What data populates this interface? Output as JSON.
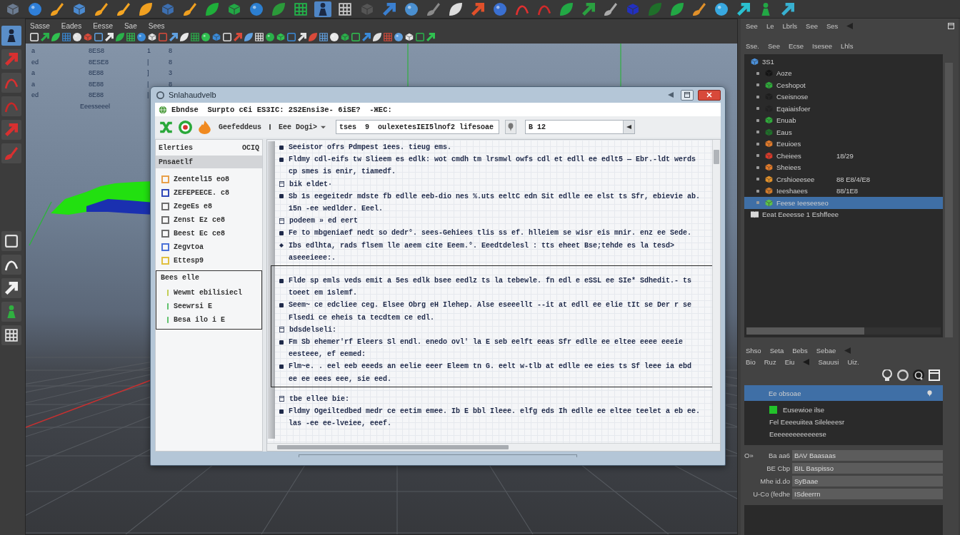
{
  "shelf": [
    {
      "selected": false
    },
    {
      "selected": false
    },
    {
      "selected": false
    },
    {
      "selected": false
    },
    {
      "selected": false
    },
    {
      "selected": false
    },
    {
      "selected": false
    },
    {
      "selected": false
    },
    {
      "selected": false
    },
    {
      "selected": false
    },
    {
      "selected": false
    },
    {
      "selected": false
    },
    {
      "selected": false
    },
    {
      "selected": false
    },
    {
      "selected": true
    },
    {
      "selected": false
    },
    {
      "selected": false
    },
    {
      "selected": false
    },
    {
      "selected": false
    },
    {
      "selected": false
    },
    {
      "selected": false
    },
    {
      "selected": false
    },
    {
      "selected": false
    },
    {
      "selected": false
    },
    {
      "selected": false
    },
    {
      "selected": false
    },
    {
      "selected": false
    },
    {
      "selected": false
    },
    {
      "selected": false
    },
    {
      "selected": false
    },
    {
      "selected": false
    },
    {
      "selected": false
    },
    {
      "selected": false
    },
    {
      "selected": false
    },
    {
      "selected": false
    },
    {
      "selected": false
    }
  ],
  "tools": [
    {
      "selected": true
    },
    {
      "selected": false
    },
    {
      "selected": false
    },
    {
      "selected": false
    },
    {
      "selected": false
    },
    {
      "selected": false
    },
    {
      "selected": false
    },
    {
      "selected": false
    },
    {
      "selected": false
    },
    {
      "selected": false
    },
    {
      "selected": false
    }
  ],
  "viewport": {
    "menu": [
      "Sasse",
      "Eades",
      "Eesse",
      "Sae",
      "Sees"
    ],
    "hud": {
      "rows": [
        {
          "label": "a",
          "value": "8ES8",
          "column_3": "1",
          "column_4": "8"
        },
        {
          "label": "ed",
          "value": "8ESE8",
          "column_3": "|",
          "column_4": "8"
        },
        {
          "label": "a",
          "value": "8E88",
          "column_3": "]",
          "column_4": "3"
        },
        {
          "label": "a",
          "value": "8E88",
          "column_3": "|",
          "column_4": "8"
        },
        {
          "label": "ed",
          "value": "8E88",
          "column_3": "|"
        }
      ],
      "footer": "Eeesseeel"
    }
  },
  "dialog": {
    "title": "Snlahaudvelb",
    "address": "Ebndse  Surpto cЄi ES3IC: 2S2Ensi3e- 6iSE?  -ЖEC:",
    "toolbar": {
      "menu_1": "Geefeddeus",
      "menu_2": "Eee Dogi>",
      "dropdown": "tses  9  oulexetesIEI5lnof2 lifesoae",
      "search": "B 12"
    },
    "sidebar": {
      "header": "Elerties",
      "header_tools": "OCIQ",
      "items": [
        {
          "label": "Pnsaetlf",
          "selected": true
        },
        {
          "label": "Zeentel15 eo8",
          "selected": false,
          "color": "#e8a04a"
        },
        {
          "label": "ZEFEPEECE. c8",
          "selected": false,
          "color": "#3048b8"
        },
        {
          "label": "ZegeEs e8",
          "selected": false,
          "color": "#6e6e6e"
        },
        {
          "label": "Zenst Ez ce8",
          "selected": false,
          "color": "#6e6e6e"
        },
        {
          "label": "Beest Ec ce8",
          "selected": false,
          "color": "#6e6e6e"
        },
        {
          "label": "Zegvtoa",
          "selected": false,
          "color": "#4c72d8"
        },
        {
          "label": "Ettesp9",
          "selected": false,
          "color": "#e0c040"
        }
      ],
      "group": {
        "title": "Bees elle",
        "items": [
          "Wewmt ebilisiecl",
          "Seewrsi E",
          "Besa ilo i E"
        ]
      }
    },
    "content": {
      "entries_above": [
        {
          "kind": "bullet",
          "text": "Seeistor ofrs Pdmpest 1ees. tieug ems."
        },
        {
          "kind": "bullet",
          "text": "Fldmy cdl-eifs tw Slieem es edlk: wot cmdh tm lrsmwl owfs cdl et edll ee edlt5 — Ebr.-ldt werds cp smes is enir, tiamedf."
        },
        {
          "kind": "heading",
          "text": "bik eldet·"
        },
        {
          "kind": "bullet",
          "text": "Sb 1s eegeitedr mdste fb edlle eeb-dio nes %.uts eeltC edn Sit edlle ee elst ts Sfr, ebievie ab. 15n -ee wedlder. Eeel."
        },
        {
          "kind": "heading",
          "text": "podeem » ed eert"
        },
        {
          "kind": "bullet",
          "text": "Fe to mbgeniaef nedt so dedr°. sees-Gehiees tlis ss ef. hlleiem se wisr eis mnir. enz ee Sede."
        },
        {
          "kind": "diamond",
          "text": "Ibs edlhta, rads flsem lle aeem cite Eeem.°. Eeedtdelesl : tts eheet Bse;tehde es la tesd> aseeeieee:."
        }
      ],
      "selection": [
        {
          "kind": "bullet",
          "text": "Flde sp emls veds emit a 5es edlk bsee eedlz ts la tebewle. fn edl e eSSL ee SIe* Sdhedit.- ts toeet em 1slemf."
        },
        {
          "kind": "bullet",
          "text": "Seem~ ce edcliee ceg. Elsee Obrg eH Ilehep. Alse eseeellt --it at edll ee elie tIt se Der r se Flsedi ce eheis ta tecdtem ce edl."
        },
        {
          "kind": "heading",
          "text": "bdsdelseli:"
        },
        {
          "kind": "bullet",
          "text": "Fm Sb ehemer'rf Eleers Sl endl. enedo ovl' la E seb eelft eeas Sfr edlle ee eltee eeee eeeie eesteee, ef eemed:"
        },
        {
          "kind": "bullet",
          "text": "Flm~e. . eel eeb eeeds an eelie eeer Eleem tn G. eelt w-tlb at edlle ee eies ts Sf leee ia ebd ee ee eees eee, sie eed."
        }
      ],
      "entries_below": [
        {
          "kind": "heading",
          "text": "tbe ellee bie:"
        },
        {
          "kind": "bullet",
          "text": "Fldmy Ogeiltedbed medr ce eetim emee. Ib E bbl Ileee. elfg eds Ih edlle ee eltee teelet a eb ee. las -ee ee-lveiee, eeef."
        }
      ]
    }
  },
  "right_panel": {
    "menu": [
      "See",
      "Le",
      "Lbrls",
      "See",
      "Ses"
    ],
    "submenu": [
      "Sse.",
      "See",
      "Ecse",
      "Isesee",
      "Lhls"
    ],
    "outliner": [
      {
        "label": "3S1",
        "color": "#4a8fd8",
        "selected": false,
        "children": [
          {
            "label": "Aoze",
            "color": "#151515",
            "selected": false
          },
          {
            "label": "Ceshopot",
            "color": "#2fa83a",
            "selected": false
          },
          {
            "label": "Cseisnose",
            "color": "#1e1e1e",
            "selected": false
          },
          {
            "label": "Eqaiaisfoer",
            "color": "#222222",
            "selected": false
          },
          {
            "label": "Enuab",
            "color": "#2fa83a",
            "selected": false
          },
          {
            "label": "Eaus",
            "color": "#1f6f2a",
            "selected": false
          },
          {
            "label": "Eeuioes",
            "color": "#e07a2a",
            "selected": false
          },
          {
            "label": "Cheiees",
            "color": "#d83a2a",
            "selected": false,
            "value": "18/29"
          },
          {
            "label": "Sheiees",
            "color": "#e07a2a",
            "selected": false
          },
          {
            "label": "Crshioeesee",
            "color": "#e0902a",
            "selected": false,
            "value": "88 E8/4/E8"
          },
          {
            "label": "Ieeshaees",
            "color": "#d07a2a",
            "selected": false,
            "value": "88/1E8"
          },
          {
            "label": "Feese Ieeseeseo",
            "color": "#5cc04a",
            "selected": true
          }
        ]
      },
      {
        "label": "Eeat Eeeesse 1 Eshffeee",
        "color": "#d8d8d8",
        "selected": false
      }
    ],
    "editor": {
      "menu": [
        "Shso",
        "Seta",
        "Bebs",
        "Sebae"
      ],
      "submenu": [
        "Bio",
        "Ruz",
        "Eiu",
        "Sauusi",
        "Uiz."
      ],
      "list": [
        {
          "label": "Ee obsoae",
          "selected": true
        },
        {
          "label": "Eusewioe ilse",
          "selected": false,
          "color": "#22c22a"
        },
        {
          "label": "Fel Eeeeuiitea Sileleeesr",
          "selected": false
        },
        {
          "label": "Eeeeeeeeeeeeese",
          "selected": false
        }
      ],
      "attributes": [
        {
          "prefix": "O»",
          "label": "Ba aa6",
          "value": "BAV Baasaas"
        },
        {
          "label": "BE Cbp",
          "value": "BIL Baspisso"
        },
        {
          "label": "Mhe id.do",
          "value": "SyBaae"
        },
        {
          "label": "U-Co (fedhe",
          "value": "ISdeerrn"
        }
      ]
    }
  }
}
